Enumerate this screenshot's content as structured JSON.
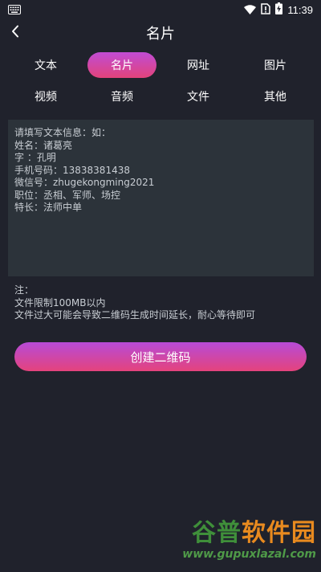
{
  "status_bar": {
    "time": "11:39",
    "icons": [
      "keyboard-icon",
      "wifi-icon",
      "no-sim-icon",
      "battery-charging-icon"
    ]
  },
  "header": {
    "title": "名片",
    "back_icon": "chevron-left-icon"
  },
  "tabs": {
    "row1": [
      "文本",
      "名片",
      "网址",
      "图片"
    ],
    "row2": [
      "视频",
      "音频",
      "文件",
      "其他"
    ],
    "active": "名片"
  },
  "text_input": {
    "placeholder": "请填写文本信息：如：\n姓名：诸葛亮\n字  ：孔明\n手机号码：13838381438\n微信号：zhugekongming2021\n职位：丞相、军师、场控\n特长：法师中单"
  },
  "note": {
    "label": "注：",
    "line1": "文件限制100MB以内",
    "line2": "文件过大可能会导致二维码生成时间延长，耐心等待即可"
  },
  "create_button": {
    "label": "创建二维码"
  },
  "watermark": {
    "title_part1": "谷普",
    "title_part2": "软件园",
    "url": "www.gupuxlazal.com"
  },
  "colors": {
    "background": "#20222c",
    "input_bg": "#2c333a",
    "gradient_start": "#b64bd8",
    "gradient_end": "#e5437c"
  }
}
